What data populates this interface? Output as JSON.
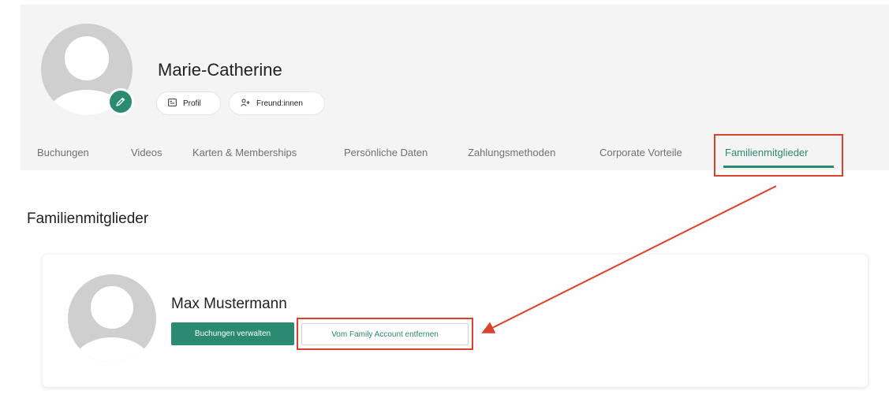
{
  "profile": {
    "name": "Marie-Catherine",
    "edit_icon": "pencil-icon",
    "buttons": [
      {
        "label": "Profil",
        "icon": "id-card-icon"
      },
      {
        "label": "Freund:innen",
        "icon": "add-user-icon"
      }
    ]
  },
  "tabs": [
    {
      "label": "Buchungen"
    },
    {
      "label": "Videos"
    },
    {
      "label": "Karten & Memberships"
    },
    {
      "label": "Persönliche Daten"
    },
    {
      "label": "Zahlungsmethoden"
    },
    {
      "label": "Corporate Vorteile"
    },
    {
      "label": "Familienmitglieder",
      "active": true
    }
  ],
  "section": {
    "title": "Familienmitglieder"
  },
  "member": {
    "name": "Max Mustermann",
    "manage_label": "Buchungen verwalten",
    "remove_label": "Vom Family Account entfernen"
  },
  "colors": {
    "accent": "#2a8a72",
    "callout": "#d9432c"
  }
}
